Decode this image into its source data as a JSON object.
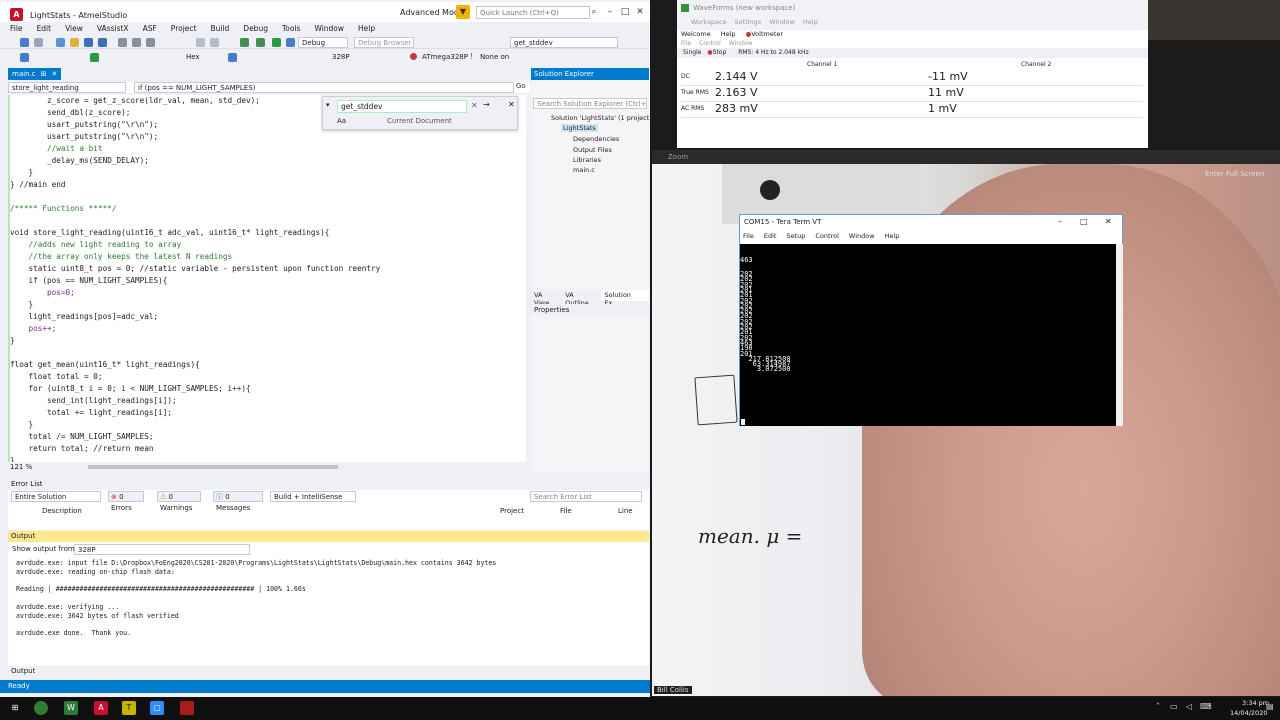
{
  "atmel": {
    "title": "LightStats - AtmelStudio",
    "mode": "Advanced Mode",
    "quick_launch_placeholder": "Quick Launch (Ctrl+Q)",
    "menu": [
      "File",
      "Edit",
      "View",
      "VAssistX",
      "ASF",
      "Project",
      "Build",
      "Debug",
      "Tools",
      "Window",
      "Help"
    ],
    "config": "Debug",
    "debug_browser": "Debug Browser",
    "search_combo": "get_stddev",
    "hex_label": "Hex",
    "device_size": "328P",
    "device": "ATmega328P",
    "tool": "None on",
    "doc_tab": "main.c",
    "nav_left": "store_light_reading",
    "nav_right": "if (pos == NUM_LIGHT_SAMPLES)",
    "go_label": "Go",
    "find_text": "get_stddev",
    "find_scope": "Current Document",
    "zoom_level": "121 %",
    "code_lines": [
      "        z_score = get_z_score(ldr_val, mean, std_dev);",
      "        send_dbl(z_score);",
      "        usart_putstring(\"\\r\\n\");",
      "        usart_putstring(\"\\r\\n\");",
      "        //wait a bit",
      "        _delay_ms(SEND_DELAY);",
      "    }",
      "} //main end",
      "",
      "/***** Functions *****/",
      "",
      "void store_light_reading(uint16_t adc_val, uint16_t* light_readings){",
      "    //adds new light reading to array",
      "    //the array only keeps the latest N readings",
      "    static uint8_t pos = 0; //static variable - persistent upon function reentry",
      "    if (pos == NUM_LIGHT_SAMPLES){",
      "        pos=0;",
      "    }",
      "    light_readings[pos]=adc_val;",
      "    pos++;",
      "}",
      "",
      "float get_mean(uint16_t* light_readings){",
      "    float total = 0;",
      "    for (uint8_t i = 0; i < NUM_LIGHT_SAMPLES; i++){",
      "        send_int(light_readings[i]);",
      "        total += light_readings[i];",
      "    }",
      "    total /= NUM_LIGHT_SAMPLES;",
      "    return total; //return mean",
      "}"
    ],
    "solution_explorer": {
      "title": "Solution Explorer",
      "search_placeholder": "Search Solution Explorer (Ctrl+;)",
      "solution": "Solution 'LightStats' (1 project)",
      "project": "LightStats",
      "items": [
        "Dependencies",
        "Output Files",
        "Libraries",
        "main.c"
      ],
      "tabs": [
        "VA View",
        "VA Outline",
        "Solution Ex..."
      ]
    },
    "properties_title": "Properties",
    "error_list": {
      "title": "Error List",
      "scope": "Entire Solution",
      "errors": "0 Errors",
      "warnings": "0 Warnings",
      "messages": "0 Messages",
      "build_filter": "Build + IntelliSense",
      "search_placeholder": "Search Error List",
      "columns": [
        "Description",
        "Project",
        "File",
        "Line"
      ]
    },
    "output": {
      "title": "Output",
      "show_from_label": "Show output from:",
      "show_from_value": "328P",
      "lines": [
        "avrdude.exe: input file D:\\Dropbox\\FoEng2020\\CS201-2020\\Programs\\LightStats\\LightStats\\Debug\\main.hex contains 3642 bytes",
        "avrdude.exe: reading on-chip flash data:",
        "",
        "Reading | ################################################## | 100% 1.66s",
        "",
        "avrdude.exe: verifying ...",
        "avrdude.exe: 3642 bytes of flash verified",
        "",
        "avrdude.exe done.  Thank you."
      ],
      "tab": "Output"
    },
    "status": "Ready"
  },
  "waveforms": {
    "title": "WaveForms (new workspace)",
    "menu1": [
      "Workspace",
      "Settings",
      "Window",
      "Help"
    ],
    "tabs": [
      "Welcome",
      "Help",
      "Voltmeter"
    ],
    "menu2": [
      "File",
      "Control",
      "Window"
    ],
    "toolbar": [
      "Single",
      "Stop",
      "RMS: 4 Hz to 2.048 kHz"
    ],
    "ch1": "Channel 1",
    "ch2": "Channel 2",
    "rows": [
      {
        "label": "DC",
        "v1": "2.144 V",
        "v2": "-11 mV"
      },
      {
        "label": "True RMS",
        "v1": "2.163 V",
        "v2": "11 mV"
      },
      {
        "label": "AC RMS",
        "v1": "283 mV",
        "v2": "1 mV"
      }
    ]
  },
  "zoom": {
    "title": "Zoom",
    "fullscreen": "Enter Full Screen",
    "participant": "Bill Collis",
    "handwriting": "mean.  μ ="
  },
  "teraterm": {
    "title": "COM15 - Tera Term VT",
    "menu": [
      "File",
      "Edit",
      "Setup",
      "Control",
      "Window",
      "Help"
    ],
    "first_line": "463",
    "lines": [
      "202",
      "202",
      "202",
      "201",
      "201",
      "202",
      "202",
      "202",
      "202",
      "202",
      "202",
      "201",
      "202",
      "463",
      "198",
      "201"
    ],
    "stats": [
      "  217.812500",
      "   63.314987",
      "    3.072500"
    ]
  },
  "taskbar": {
    "time": "3:34 pm",
    "date": "14/04/2020"
  }
}
